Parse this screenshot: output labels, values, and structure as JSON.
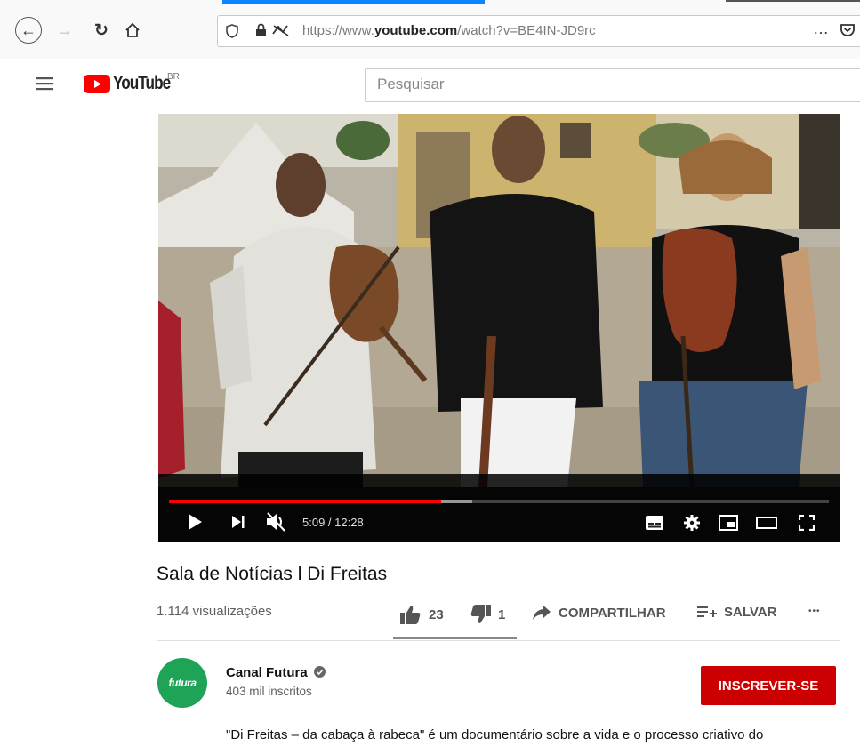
{
  "browser": {
    "url_prefix": "https://www.",
    "url_domain": "youtube.com",
    "url_path": "/watch?v=BE4IN-JD9rc",
    "menu_label": "…"
  },
  "youtube": {
    "logo_text": "YouTube",
    "region": "BR",
    "search_placeholder": "Pesquisar"
  },
  "player": {
    "time": "5:09 / 12:28",
    "progress_fraction": 0.412,
    "buffered_fraction": 0.46
  },
  "video": {
    "title": "Sala de Notícias l Di Freitas",
    "views": "1.114 visualizações",
    "likes": "23",
    "dislikes": "1",
    "share_label": "COMPARTILHAR",
    "save_label": "SALVAR",
    "more_label": "•••"
  },
  "channel": {
    "name": "Canal Futura",
    "avatar_text": "futura",
    "subscribers": "403 mil inscritos",
    "subscribe_label": "INSCREVER-SE"
  },
  "description": "\"Di Freitas – da cabaça à rabeca\" é um documentário sobre a vida e o processo criativo do",
  "colors": {
    "accent_red": "#cc0000",
    "progress_red": "#ff0000",
    "avatar_green": "#1fa357"
  }
}
